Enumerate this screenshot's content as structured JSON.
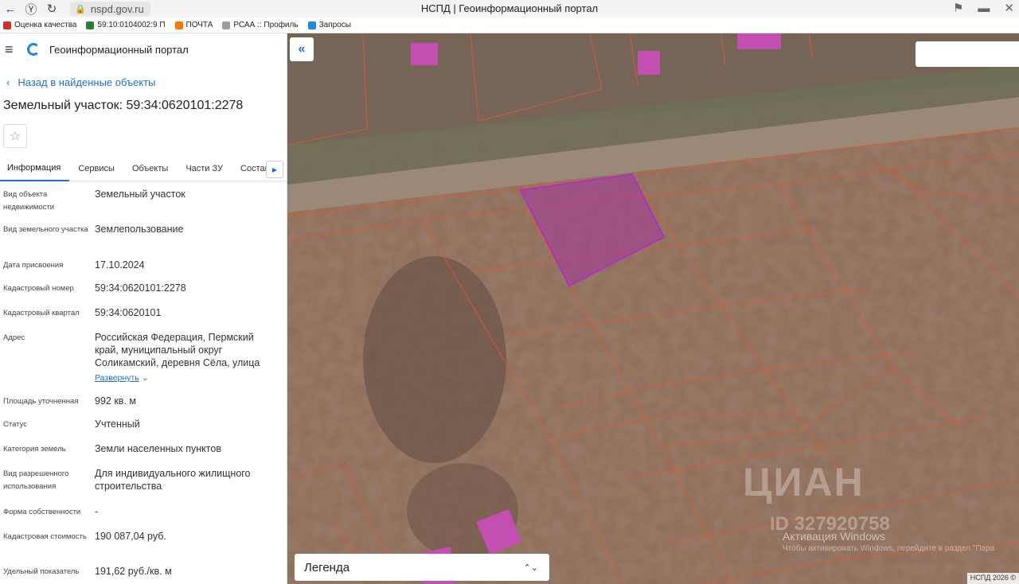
{
  "browser": {
    "url": "nspd.gov.ru",
    "title": "НСПД | Геоинформационный портал",
    "bookmarks": [
      {
        "label": "Оценка качества",
        "color": "#d32f2f"
      },
      {
        "label": "59:10:0104002:9 П",
        "color": "#2e7d32"
      },
      {
        "label": "ПОЧТА",
        "color": "#f57c00"
      },
      {
        "label": "РСАА :: Профиль",
        "color": "#9e9e9e"
      },
      {
        "label": "Запросы",
        "color": "#1e88e5"
      }
    ]
  },
  "app": {
    "title": "Геоинформационный портал",
    "back_label": "Назад в найденные объекты",
    "object_title": "Земельный участок: 59:34:0620101:2278",
    "tabs": [
      "Информация",
      "Сервисы",
      "Объекты",
      "Части ЗУ",
      "Состав"
    ],
    "props": [
      {
        "label": "Вид объекта недвижимости",
        "value": "Земельный участок"
      },
      {
        "label": "Вид земельного участка",
        "value": "Землепользование"
      },
      {
        "label": "Дата присвоения",
        "value": "17.10.2024"
      },
      {
        "label": "Кадастровый номер",
        "value": "59:34:0620101:2278"
      },
      {
        "label": "Кадастровый квартал",
        "value": "59:34:0620101"
      },
      {
        "label": "Адрес",
        "value": "Российская Федерация, Пермский край, муниципальный округ Соликамский, деревня Сёла, улица"
      },
      {
        "label": "Площадь уточненная",
        "value": "992 кв. м"
      },
      {
        "label": "Статус",
        "value": "Учтенный"
      },
      {
        "label": "Категория земель",
        "value": "Земли населенных пунктов"
      },
      {
        "label": "Вид разрешенного использования",
        "value": "Для индивидуального жилищного строительства"
      },
      {
        "label": "Форма собственности",
        "value": "-"
      },
      {
        "label": "Кадастровая стоимость",
        "value": "190 087,04 руб."
      },
      {
        "label": "Удельный показатель",
        "value": "191,62 руб./кв. м"
      }
    ],
    "expand_label": "Развернуть"
  },
  "map": {
    "legend_label": "Легенда",
    "watermark": "ЦИАН",
    "watermark_id": "ID 327920758",
    "windows_activation": "Активация Windows",
    "windows_activation_hint": "Чтобы активировать Windows, перейдите в раздел \"Пара",
    "copyright": "НСПД 2026 ©"
  }
}
